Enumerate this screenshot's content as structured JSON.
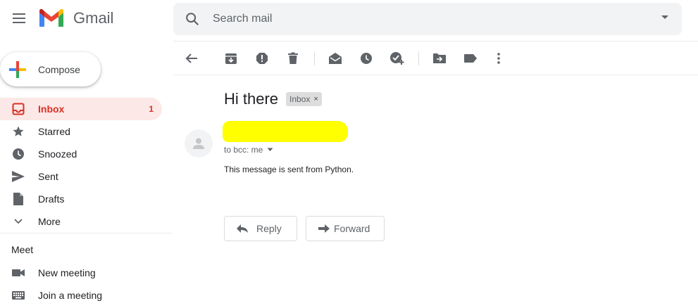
{
  "app": {
    "name": "Gmail"
  },
  "search": {
    "placeholder": "Search mail"
  },
  "compose": {
    "label": "Compose"
  },
  "sidebar": {
    "items": [
      {
        "label": "Inbox",
        "count": "1",
        "icon": "inbox-icon"
      },
      {
        "label": "Starred",
        "icon": "star-icon"
      },
      {
        "label": "Snoozed",
        "icon": "clock-icon"
      },
      {
        "label": "Sent",
        "icon": "send-icon"
      },
      {
        "label": "Drafts",
        "icon": "draft-icon"
      },
      {
        "label": "More",
        "icon": "chevron-down-icon"
      }
    ],
    "meet": {
      "title": "Meet",
      "items": [
        {
          "label": "New meeting",
          "icon": "videocam-icon"
        },
        {
          "label": "Join a meeting",
          "icon": "keyboard-icon"
        }
      ]
    }
  },
  "toolbar": {
    "icons": [
      "back-icon",
      "archive-icon",
      "report-spam-icon",
      "delete-icon",
      "mark-unread-icon",
      "snooze-icon",
      "add-to-tasks-icon",
      "move-to-icon",
      "label-icon",
      "more-vert-icon"
    ]
  },
  "message": {
    "subject": "Hi there",
    "label": "Inbox",
    "label_remove": "×",
    "recipient": "to bcc: me",
    "body": "This message is sent from Python.",
    "reply_label": "Reply",
    "forward_label": "Forward"
  },
  "colors": {
    "accent_red": "#d93025",
    "active_bg": "#fce8e6",
    "redaction": "#ffff00",
    "search_bg": "#f1f3f4"
  }
}
